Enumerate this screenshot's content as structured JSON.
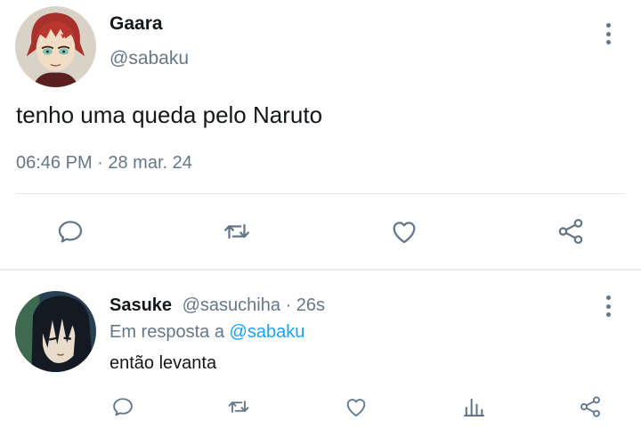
{
  "colors": {
    "text": "#14171a",
    "secondary": "#657786",
    "link": "#1da1f2",
    "divider": "#e1e8ed"
  },
  "tweet": {
    "author_name": "Gaara",
    "author_handle": "@sabaku",
    "text": "tenho uma queda pelo Naruto",
    "timestamp": "06:46 PM · 28 mar. 24",
    "actions": [
      "reply-icon",
      "retweet-icon",
      "like-icon",
      "share-icon"
    ]
  },
  "reply": {
    "author_name": "Sasuke",
    "author_handle": "@sasuchiha",
    "separator": "·",
    "time": "26s",
    "reply_to_prefix": "Em resposta a",
    "reply_to_handle": "@sabaku",
    "text": "então levanta",
    "actions": [
      "reply-icon",
      "retweet-icon",
      "like-icon",
      "analytics-icon",
      "share-icon"
    ]
  }
}
